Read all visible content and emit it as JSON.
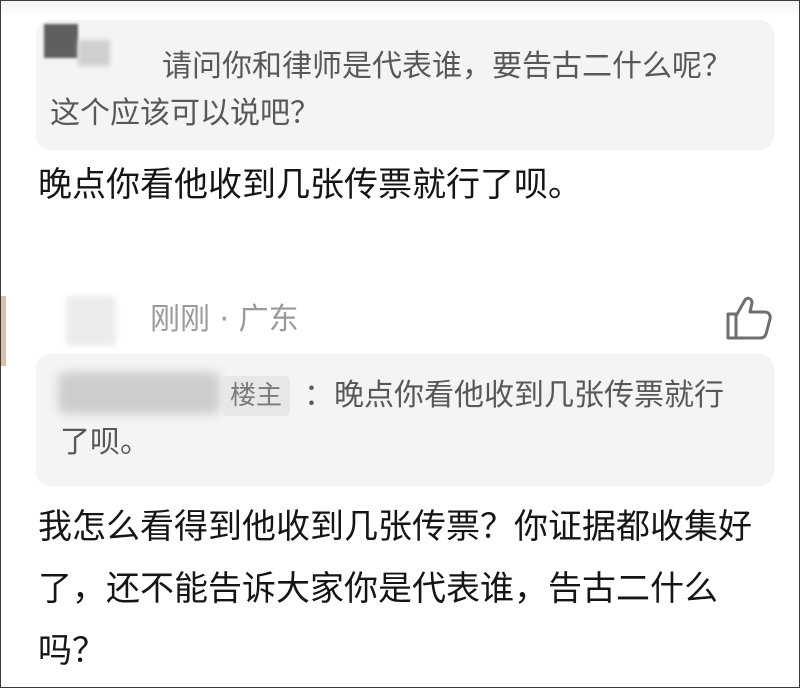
{
  "quote1": {
    "text": "请问你和律师是代表谁，要告古二什么呢？这个应该可以说吧？"
  },
  "reply1": {
    "text": "晚点你看他收到几张传票就行了呗。"
  },
  "comment2": {
    "time": "刚刚",
    "separator": "·",
    "location": "广东",
    "like_icon": "thumbs-up-icon"
  },
  "quote2": {
    "tag": "楼主",
    "text": "：晚点你看他收到几张传票就行了呗。"
  },
  "reply2": {
    "text": "我怎么看得到他收到几张传票？你证据都收集好了，还不能告诉大家你是代表谁，告古二什么吗？"
  }
}
